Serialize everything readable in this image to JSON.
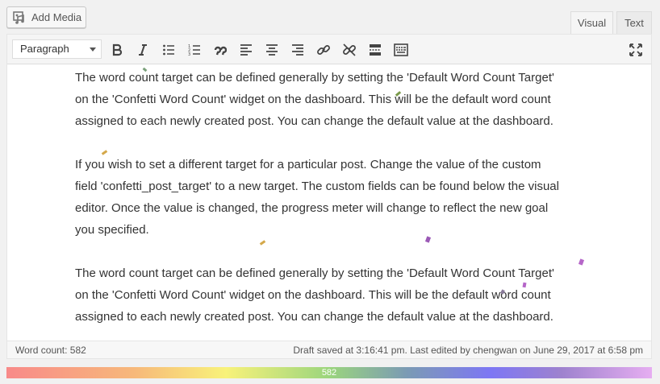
{
  "media_button": {
    "label": "Add Media"
  },
  "tabs": [
    {
      "label": "Visual",
      "active": true
    },
    {
      "label": "Text",
      "active": false
    }
  ],
  "toolbar": {
    "format_select": "Paragraph",
    "buttons": [
      "bold-icon",
      "italic-icon",
      "bulleted-list-icon",
      "numbered-list-icon",
      "blockquote-icon",
      "align-left-icon",
      "align-center-icon",
      "align-right-icon",
      "link-icon",
      "unlink-icon",
      "read-more-icon",
      "toolbar-toggle-icon",
      "fullscreen-icon"
    ]
  },
  "content": {
    "paragraphs": [
      {
        "lines": [
          "The word count target can be defined generally by setting the 'Default Word Count Target'",
          "on the 'Confetti Word Count' widget on the dashboard. This will be the default word count",
          "assigned to each newly created post. You can change the default value at the dashboard."
        ]
      },
      {
        "lines": [
          "If you wish to set a different target for a particular post. Change the value of the custom",
          "field 'confetti_post_target'  to a new target. The custom fields can be found below the visual",
          "editor.  Once the value is changed, the progress meter will change to reflect the new goal",
          "you specified."
        ]
      },
      {
        "lines": [
          "The word count target can be defined generally by setting the 'Default Word Count Target'",
          "on the 'Confetti Word Count' widget on the dashboard. This will be the default word count",
          "assigned to each newly created post. You can change the default value at the dashboard."
        ]
      }
    ]
  },
  "status": {
    "word_count": "Word count: 582",
    "draft_info": "Draft saved at 3:16:41 pm. Last edited by chengwan on June 29, 2017 at 6:58 pm"
  },
  "progress": {
    "label": "582",
    "fraction": 1.0
  },
  "colors": {
    "progress_start": "#f88a89",
    "progress_end": "#e6aef1",
    "confetti": [
      "#9b59b6",
      "#d4a84a",
      "#7a9a4a",
      "#b566c8"
    ]
  }
}
